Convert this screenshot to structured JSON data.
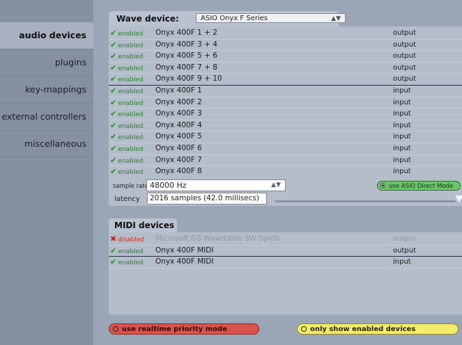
{
  "sidebar": {
    "items": [
      {
        "label": "audio devices",
        "active": true
      },
      {
        "label": "plugins",
        "active": false
      },
      {
        "label": "key-mappings",
        "active": false
      },
      {
        "label": "external controllers",
        "active": false
      },
      {
        "label": "miscellaneous",
        "active": false
      }
    ]
  },
  "wave": {
    "tab_label": "Wave device:",
    "selected_device": "ASIO Onyx F Series",
    "devices": [
      {
        "status": "enabled",
        "name": "Onyx 400F 1 + 2",
        "direction": "output"
      },
      {
        "status": "enabled",
        "name": "Onyx 400F 3 + 4",
        "direction": "output"
      },
      {
        "status": "enabled",
        "name": "Onyx 400F 5 + 6",
        "direction": "output"
      },
      {
        "status": "enabled",
        "name": "Onyx 400F 7 + 8",
        "direction": "output"
      },
      {
        "status": "enabled",
        "name": "Onyx 400F 9 + 10",
        "direction": "output"
      },
      {
        "status": "enabled",
        "name": "Onyx 400F 1",
        "direction": "input"
      },
      {
        "status": "enabled",
        "name": "Onyx 400F 2",
        "direction": "input"
      },
      {
        "status": "enabled",
        "name": "Onyx 400F 3",
        "direction": "input"
      },
      {
        "status": "enabled",
        "name": "Onyx 400F 4",
        "direction": "input"
      },
      {
        "status": "enabled",
        "name": "Onyx 400F 5",
        "direction": "input"
      },
      {
        "status": "enabled",
        "name": "Onyx 400F 6",
        "direction": "input"
      },
      {
        "status": "enabled",
        "name": "Onyx 400F 7",
        "direction": "input"
      },
      {
        "status": "enabled",
        "name": "Onyx 400F 8",
        "direction": "input"
      }
    ],
    "sample_rate_label": "sample rate",
    "sample_rate_value": "48000 Hz",
    "latency_label": "latency",
    "latency_value": "2016 samples  (42.0 millisecs)",
    "asio_direct_label": "use ASIO Direct Mode"
  },
  "midi": {
    "tab_label": "MIDI devices",
    "devices": [
      {
        "status": "disabled",
        "name": "Microsoft GS Wavetable SW Synth",
        "direction": "output"
      },
      {
        "status": "enabled",
        "name": "Onyx 400F MIDI",
        "direction": "output"
      },
      {
        "status": "enabled",
        "name": "Onyx 400F MIDI",
        "direction": "input"
      }
    ]
  },
  "buttons": {
    "realtime_label": "use realtime priority mode",
    "only_enabled_label": "only show enabled devices"
  },
  "colors": {
    "enabled_check": "#1f8a1f",
    "disabled_cross": "#cc2222",
    "asio_button": "#6dc46f",
    "realtime_button": "#d9534f",
    "only_enabled_button": "#f2ec6a"
  }
}
